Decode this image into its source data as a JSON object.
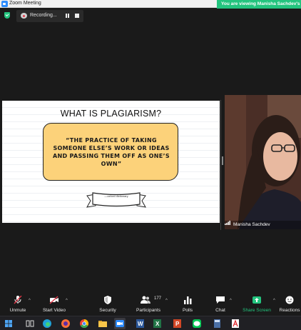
{
  "window": {
    "title": "Zoom Meeting"
  },
  "banner": {
    "text": "You are viewing Manisha Sachdev's screen"
  },
  "recording": {
    "label": "Recording..."
  },
  "slide": {
    "title": "WHAT IS PLAGIARISM?",
    "quote": "“The practice of taking someone else’s work or ideas and passing them off as one’s own”",
    "source": "—oxford dictionary"
  },
  "participant": {
    "name": "Manisha Sachdev"
  },
  "toolbar": {
    "unmute": "Unmute",
    "start_video": "Start Video",
    "security": "Security",
    "participants": "Participants",
    "participants_count": "177",
    "polls": "Polls",
    "chat": "Chat",
    "share_screen": "Share Screen",
    "reactions": "Reactions"
  },
  "colors": {
    "zoom_green": "#23c47e",
    "mute_red": "#e0394a",
    "slide_box": "#fcd27a"
  }
}
